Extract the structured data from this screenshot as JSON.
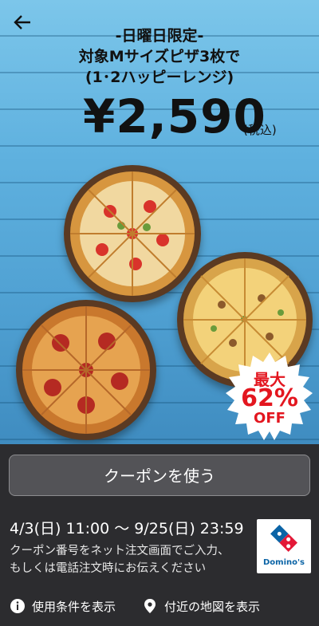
{
  "header": {
    "title_line1": "-日曜日限定-",
    "title_line2": "対象Mサイズピザ3枚で",
    "title_line3": "(1･2ハッピーレンジ)",
    "price": "¥2,590",
    "tax_note": "(税込)"
  },
  "badge": {
    "line1": "最大",
    "line2": "62%",
    "line3": "OFF"
  },
  "coupon_button": {
    "label": "クーポンを使う"
  },
  "details": {
    "validity": "4/3(日) 11:00 〜 9/25(日) 23:59",
    "description_line1": "クーポン番号をネット注文画面でご入力、",
    "description_line2": "もしくは電話注文時にお伝えください",
    "logo_text": "Domino's"
  },
  "links": {
    "terms": "使用条件を表示",
    "map": "付近の地図を表示"
  },
  "icons": {
    "back": "arrow-left-icon",
    "info": "info-icon",
    "location": "map-pin-icon"
  },
  "colors": {
    "badge_red": "#e3161f",
    "logo_blue": "#0b64a6",
    "bottom_bg": "#2c2c2f"
  }
}
